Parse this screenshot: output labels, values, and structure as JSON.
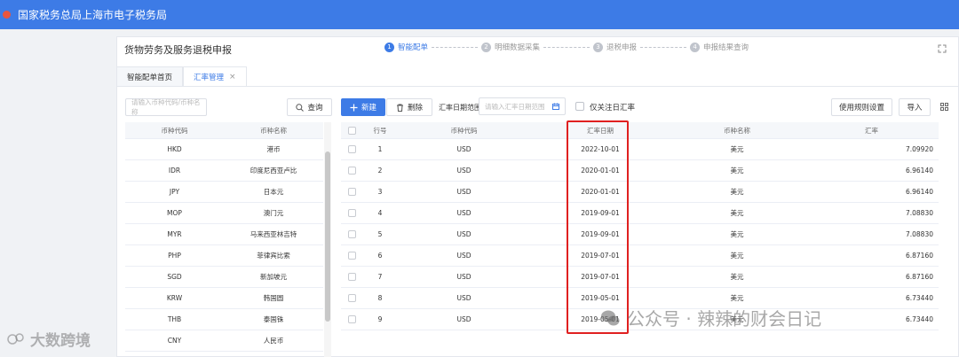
{
  "header": {
    "title": "国家税务总局上海市电子税务局"
  },
  "module": {
    "title": "货物劳务及服务退税申报"
  },
  "steps": [
    {
      "num": "1",
      "label": "智能配单"
    },
    {
      "num": "2",
      "label": "明细数据采集"
    },
    {
      "num": "3",
      "label": "退税申报"
    },
    {
      "num": "4",
      "label": "申报结果查询"
    }
  ],
  "tabs": [
    {
      "label": "智能配单首页"
    },
    {
      "label": "汇率管理",
      "close": "×"
    }
  ],
  "left": {
    "search_placeholder": "请输入币种代码/币种名称",
    "query_label": "查询",
    "columns": [
      "币种代码",
      "币种名称"
    ],
    "rows": [
      [
        "HKD",
        "港币"
      ],
      [
        "IDR",
        "印度尼西亚卢比"
      ],
      [
        "JPY",
        "日本元"
      ],
      [
        "MOP",
        "澳门元"
      ],
      [
        "MYR",
        "马来西亚林吉特"
      ],
      [
        "PHP",
        "菲律宾比索"
      ],
      [
        "SGD",
        "新加坡元"
      ],
      [
        "KRW",
        "韩国圆"
      ],
      [
        "THB",
        "泰国铢"
      ],
      [
        "CNY",
        "人民币"
      ]
    ]
  },
  "toolbar": {
    "new_label": "新建",
    "delete_label": "删除",
    "date_range_label": "汇率日期范围",
    "date_placeholder": "请输入汇率日期范围",
    "only_label": "仅关注日汇率",
    "rules_label": "使用规则设置",
    "import_label": "导入"
  },
  "right": {
    "columns": [
      "行号",
      "币种代码",
      "汇率日期",
      "币种名称",
      "汇率"
    ],
    "rows": [
      [
        "1",
        "USD",
        "2022-10-01",
        "美元",
        "7.09920"
      ],
      [
        "2",
        "USD",
        "2020-01-01",
        "美元",
        "6.96140"
      ],
      [
        "3",
        "USD",
        "2020-01-01",
        "美元",
        "6.96140"
      ],
      [
        "4",
        "USD",
        "2019-09-01",
        "美元",
        "7.08830"
      ],
      [
        "5",
        "USD",
        "2019-09-01",
        "美元",
        "7.08830"
      ],
      [
        "6",
        "USD",
        "2019-07-01",
        "美元",
        "6.87160"
      ],
      [
        "7",
        "USD",
        "2019-07-01",
        "美元",
        "6.87160"
      ],
      [
        "8",
        "USD",
        "2019-05-01",
        "美元",
        "6.73440"
      ],
      [
        "9",
        "USD",
        "2019-05-01",
        "美元",
        "6.73440"
      ]
    ]
  },
  "watermarks": [
    "大数跨境",
    "公众号 · 辣辣的财会日记"
  ],
  "colors": {
    "accent": "#3d7be6",
    "highlight": "#e02020"
  }
}
